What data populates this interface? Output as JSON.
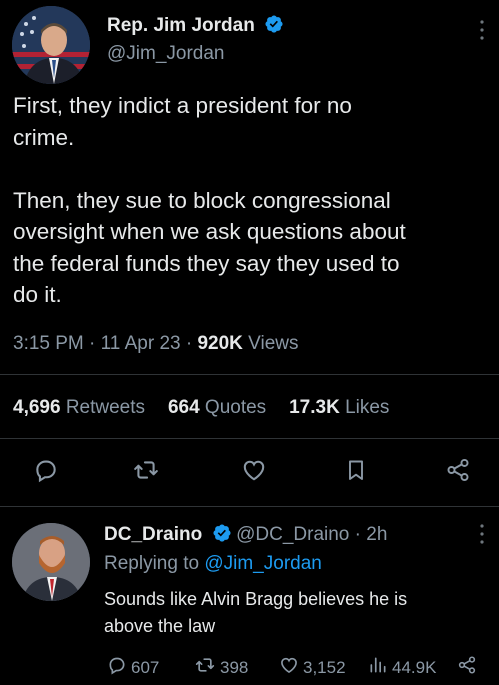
{
  "tweet": {
    "author_name": "Rep. Jim Jordan",
    "author_handle": "@Jim_Jordan",
    "text_line1": "First, they indict a president for no",
    "text_line2": "crime.",
    "text_line3": "Then, they sue to block congressional",
    "text_line4": "oversight when we ask questions about",
    "text_line5": "the federal funds they say they used to",
    "text_line6": "do it.",
    "time": "3:15 PM · 11 Apr 23 · ",
    "views_count": "920K",
    "views_label": " Views",
    "retweets_count": "4,696",
    "retweets_label": " Retweets",
    "quotes_count": "664",
    "quotes_label": " Quotes",
    "likes_count": "17.3K",
    "likes_label": " Likes"
  },
  "reply": {
    "author_name": "DC_Draino",
    "author_handle": "@DC_Draino",
    "time": " · 2h",
    "replying_prefix": "Replying to ",
    "replying_handle": "@Jim_Jordan",
    "text_line1": "Sounds like Alvin Bragg believes he is",
    "text_line2": "above the law",
    "replies": "607",
    "retweets": "398",
    "likes": "3,152",
    "views": "44.9K"
  },
  "colors": {
    "verified": "#1d9bf0",
    "muted": "#8b98a5",
    "divider": "#2f3336",
    "link": "#1d9bf0"
  },
  "icons": [
    "verified-badge-icon",
    "more-icon",
    "reply-icon",
    "retweet-icon",
    "like-icon",
    "bookmark-icon",
    "share-icon",
    "views-icon"
  ]
}
